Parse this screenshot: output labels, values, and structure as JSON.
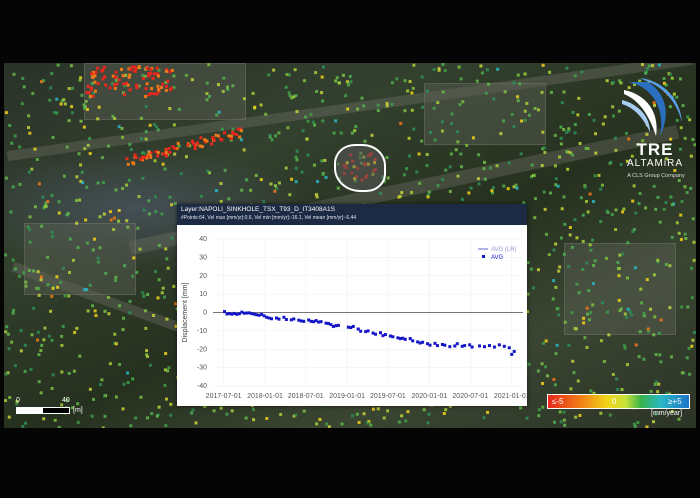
{
  "panel": {
    "title": "Layer:NAPOLI_SINKHOLE_TSX_T93_D_IT3408A1S",
    "stats": "#Points:64, Vel max [mm/yr]:0.6, Vel min [mm/yr]:-16.1, Vel mean [mm/yr]:-6.44"
  },
  "logo": {
    "line1": "TRE",
    "line2": "ALTAMiRA",
    "line3": "A CLS Group Company"
  },
  "scale_bar": {
    "start": "0",
    "end": "40",
    "unit": "[m]"
  },
  "color_legend": {
    "min_label": "≤-5",
    "mid_label": "0",
    "max_label": "≥+5",
    "unit": "[mm/year]",
    "colors": [
      "#e8271d",
      "#f07a16",
      "#f2d51a",
      "#38b24a",
      "#2bb8c6",
      "#1e73c8"
    ]
  },
  "chart_data": {
    "type": "scatter",
    "ylabel": "Displacement [mm]",
    "ylim": [
      -40,
      40
    ],
    "yticks": [
      40,
      30,
      20,
      10,
      0,
      -10,
      -20,
      -30,
      -40
    ],
    "xticks": [
      "2017-07-01",
      "2018-01-01",
      "2018-07-01",
      "2019-01-01",
      "2019-07-01",
      "2020-01-01",
      "2020-07-01",
      "2021-01-01"
    ],
    "xlim": [
      "2017-05-15",
      "2021-02-20"
    ],
    "legend_position": "top-right",
    "series": [
      {
        "name": "AVG (LR)",
        "kind": "line",
        "color": "#9a9ad8",
        "x": [],
        "y": []
      },
      {
        "name": "AVG",
        "kind": "markers",
        "color": "#1515c8",
        "x": [
          "2017-07-05",
          "2017-07-16",
          "2017-07-27",
          "2017-08-07",
          "2017-08-18",
          "2017-08-29",
          "2017-09-09",
          "2017-09-20",
          "2017-10-01",
          "2017-10-12",
          "2017-10-23",
          "2017-11-03",
          "2017-11-14",
          "2017-11-25",
          "2017-12-06",
          "2017-12-17",
          "2017-12-28",
          "2018-01-08",
          "2018-01-19",
          "2018-01-30",
          "2018-02-21",
          "2018-03-04",
          "2018-03-26",
          "2018-04-06",
          "2018-04-28",
          "2018-05-09",
          "2018-05-31",
          "2018-06-11",
          "2018-06-22",
          "2018-07-14",
          "2018-07-25",
          "2018-08-05",
          "2018-08-16",
          "2018-08-27",
          "2018-09-07",
          "2018-09-29",
          "2018-10-10",
          "2018-10-21",
          "2018-11-01",
          "2018-11-12",
          "2018-11-23",
          "2019-01-06",
          "2019-01-17",
          "2019-01-28",
          "2019-02-19",
          "2019-03-02",
          "2019-03-24",
          "2019-04-04",
          "2019-04-26",
          "2019-05-07",
          "2019-05-29",
          "2019-06-09",
          "2019-06-20",
          "2019-07-12",
          "2019-07-23",
          "2019-08-14",
          "2019-08-25",
          "2019-09-05",
          "2019-09-16",
          "2019-10-08",
          "2019-10-19",
          "2019-11-10",
          "2019-11-21",
          "2019-12-02",
          "2019-12-24",
          "2020-01-04",
          "2020-01-26",
          "2020-02-06",
          "2020-02-28",
          "2020-03-10",
          "2020-04-01",
          "2020-04-23",
          "2020-05-04",
          "2020-05-26",
          "2020-06-06",
          "2020-06-28",
          "2020-07-09",
          "2020-08-11",
          "2020-09-02",
          "2020-09-24",
          "2020-10-16",
          "2020-11-07",
          "2020-11-29",
          "2020-12-21",
          "2021-01-01",
          "2021-01-12"
        ],
        "y": [
          0.5,
          -0.8,
          -0.6,
          -0.9,
          -0.5,
          -1.0,
          -0.7,
          0.2,
          -0.4,
          -0.3,
          -0.2,
          -0.6,
          -0.9,
          -1.2,
          -1.5,
          -1.0,
          -1.8,
          -2.6,
          -3.0,
          -3.4,
          -3.0,
          -3.6,
          -2.6,
          -3.8,
          -4.0,
          -3.5,
          -4.2,
          -4.6,
          -4.8,
          -4.1,
          -4.8,
          -5.0,
          -4.4,
          -5.2,
          -5.0,
          -5.8,
          -6.0,
          -6.6,
          -7.6,
          -7.2,
          -7.0,
          -8.0,
          -8.2,
          -7.6,
          -9.0,
          -10.2,
          -10.4,
          -10.0,
          -11.2,
          -11.8,
          -11.0,
          -12.6,
          -12.0,
          -12.8,
          -13.2,
          -13.8,
          -14.2,
          -14.0,
          -14.6,
          -14.2,
          -15.4,
          -16.0,
          -16.6,
          -16.2,
          -17.0,
          -17.8,
          -16.8,
          -18.0,
          -17.4,
          -17.8,
          -18.6,
          -18.2,
          -17.0,
          -18.4,
          -18.0,
          -17.6,
          -18.8,
          -18.2,
          -18.6,
          -18.0,
          -18.8,
          -17.6,
          -18.4,
          -19.2,
          -22.8,
          -21.2
        ]
      }
    ]
  }
}
